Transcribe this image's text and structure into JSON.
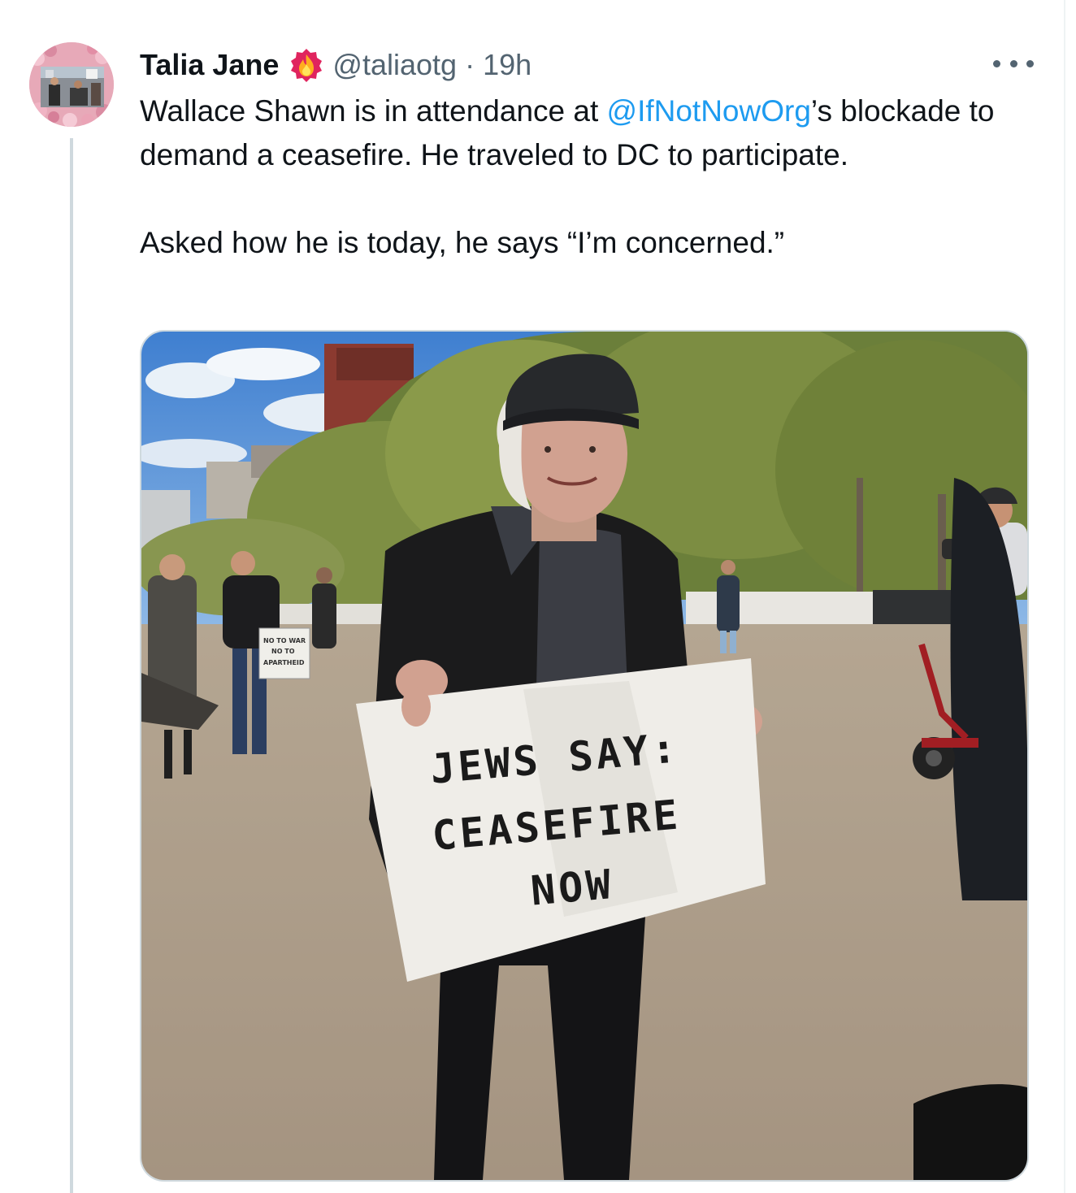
{
  "tweet": {
    "author_name": "Talia Jane",
    "handle": "@taliaotg",
    "separator": "·",
    "timestamp": "19h",
    "text": {
      "line1_before": "Wallace Shawn is in attendance at ",
      "mention": "@IfNotNowOrg",
      "line1_after": "’s blockade to demand a ceasefire. He traveled to DC to participate.",
      "paragraph2": "Asked how he is today, he says “I’m concerned.”"
    }
  },
  "media": {
    "sign_text_lines": [
      "JEWS SAY:",
      "CEASEFIRE",
      "NOW"
    ],
    "small_sign_lines": [
      "NO TO WAR",
      "NO TO",
      "APARTHEID"
    ]
  },
  "icons": {
    "verified": "flame-badge-icon",
    "more": "more-options-icon"
  },
  "colors": {
    "mention": "#1d9bf0",
    "secondary_text": "#536471",
    "thread_line": "#cfd9de"
  }
}
